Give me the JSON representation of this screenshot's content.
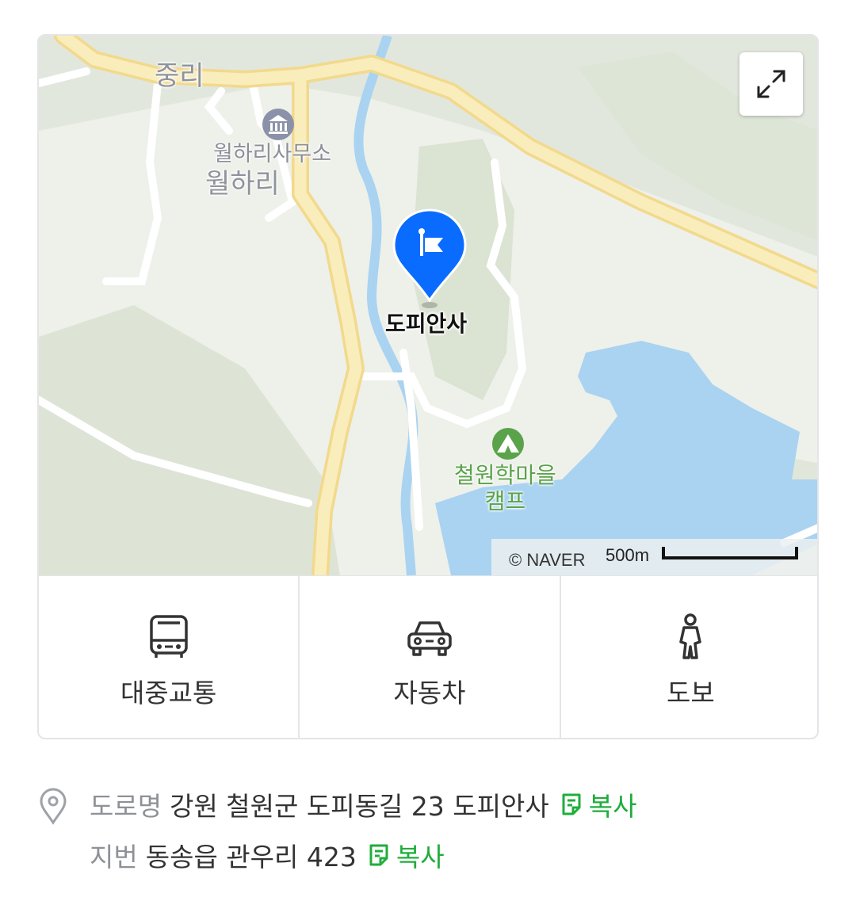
{
  "map": {
    "labels": {
      "village_jungri": "중리",
      "office": "월하리사무소",
      "village_wolhari": "월하리",
      "target": "도피안사",
      "camp_line1": "철원학마을",
      "camp_line2": "캠프"
    },
    "copyright": "© NAVER",
    "scale": "500m",
    "colors": {
      "marker": "#0a6cff",
      "water": "#a9d3f1",
      "road_major": "#f7e3a1",
      "camp": "#5aa34a"
    }
  },
  "modes": [
    {
      "label": "대중교통",
      "icon": "bus-icon"
    },
    {
      "label": "자동차",
      "icon": "car-icon"
    },
    {
      "label": "도보",
      "icon": "walking-person-icon"
    }
  ],
  "address": {
    "road": {
      "kind": "도로명",
      "value": "강원 철원군 도피동길 23 도피안사",
      "copy": "복사"
    },
    "lot": {
      "kind": "지번",
      "value": "동송읍 관우리 423",
      "copy": "복사"
    }
  }
}
